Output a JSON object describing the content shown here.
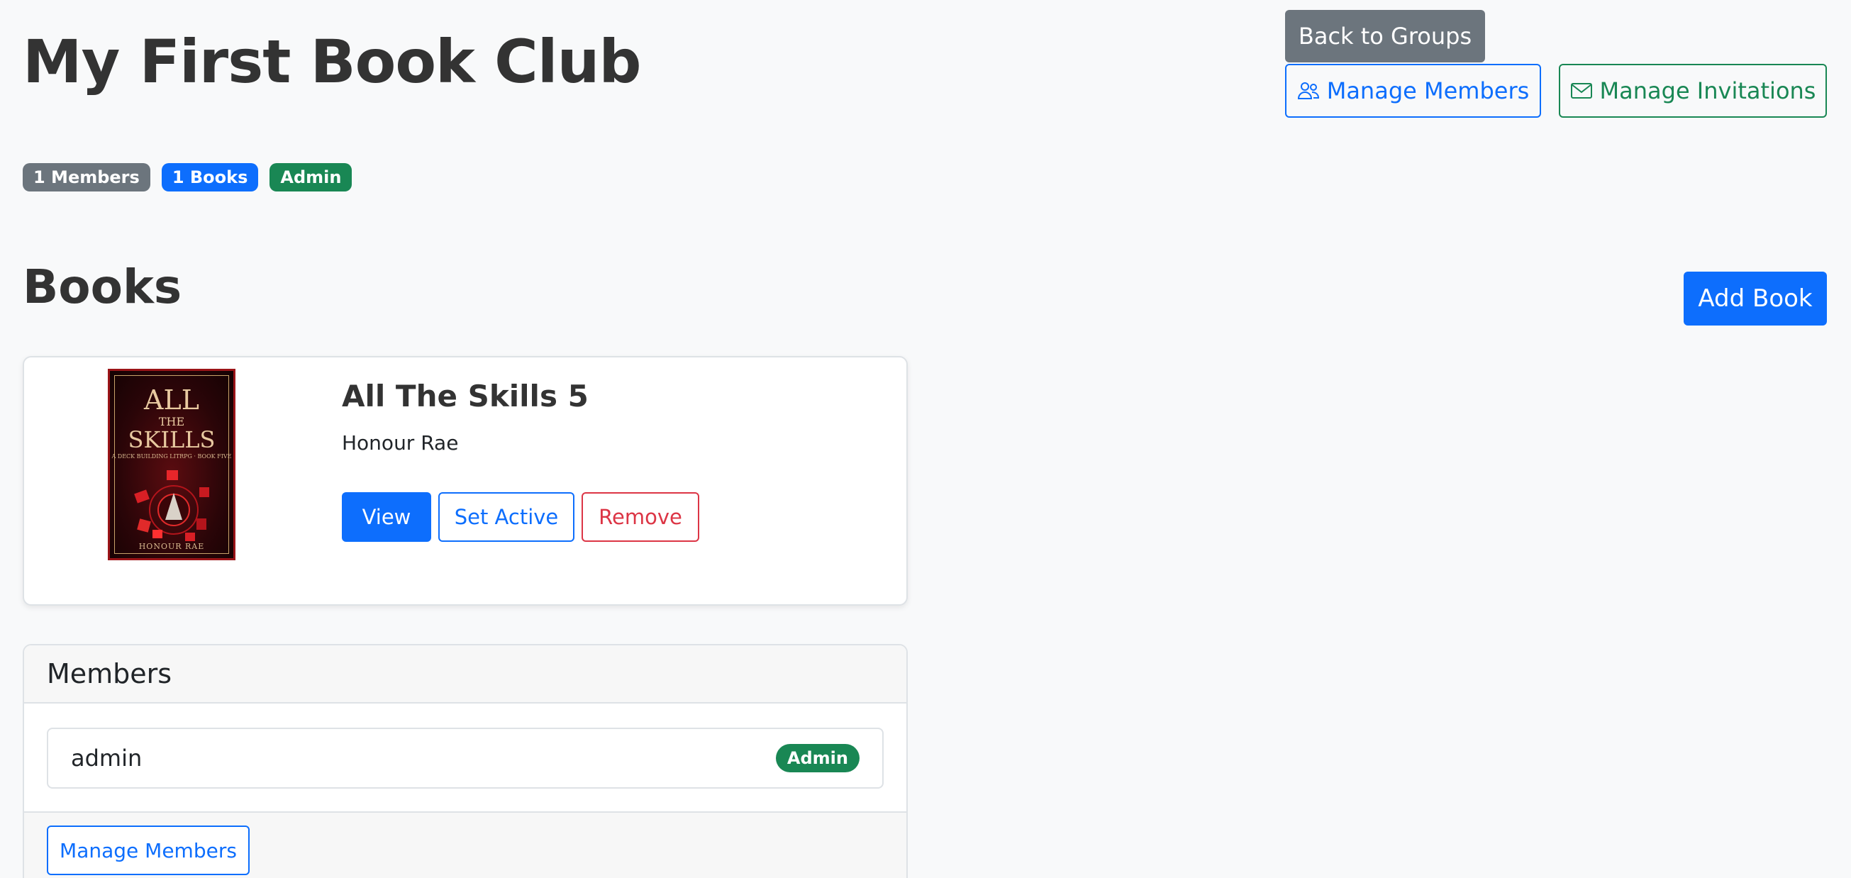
{
  "header": {
    "title": "My First Book Club",
    "back_label": "Back to Groups",
    "manage_members_label": "Manage Members",
    "manage_invitations_label": "Manage Invitations"
  },
  "badges": {
    "members": "1 Members",
    "books": "1 Books",
    "role": "Admin"
  },
  "books_section": {
    "title": "Books",
    "add_book_label": "Add Book",
    "items": [
      {
        "title": "All The Skills 5",
        "author": "Honour Rae",
        "cover": {
          "line1": "ALL",
          "line2": "THE",
          "line3": "SKILLS",
          "subtitle": "A DECK BUILDING LITRPG · BOOK FIVE",
          "author": "HONOUR RAE"
        },
        "view_label": "View",
        "set_active_label": "Set Active",
        "remove_label": "Remove"
      }
    ]
  },
  "members_section": {
    "title": "Members",
    "members": [
      {
        "name": "admin",
        "role": "Admin"
      }
    ],
    "manage_members_label": "Manage Members"
  },
  "colors": {
    "primary": "#0d6efd",
    "secondary": "#6c757d",
    "success": "#198754",
    "danger": "#dc3545"
  },
  "icons": {
    "manage_members": "people-icon",
    "manage_invitations": "envelope-icon"
  }
}
